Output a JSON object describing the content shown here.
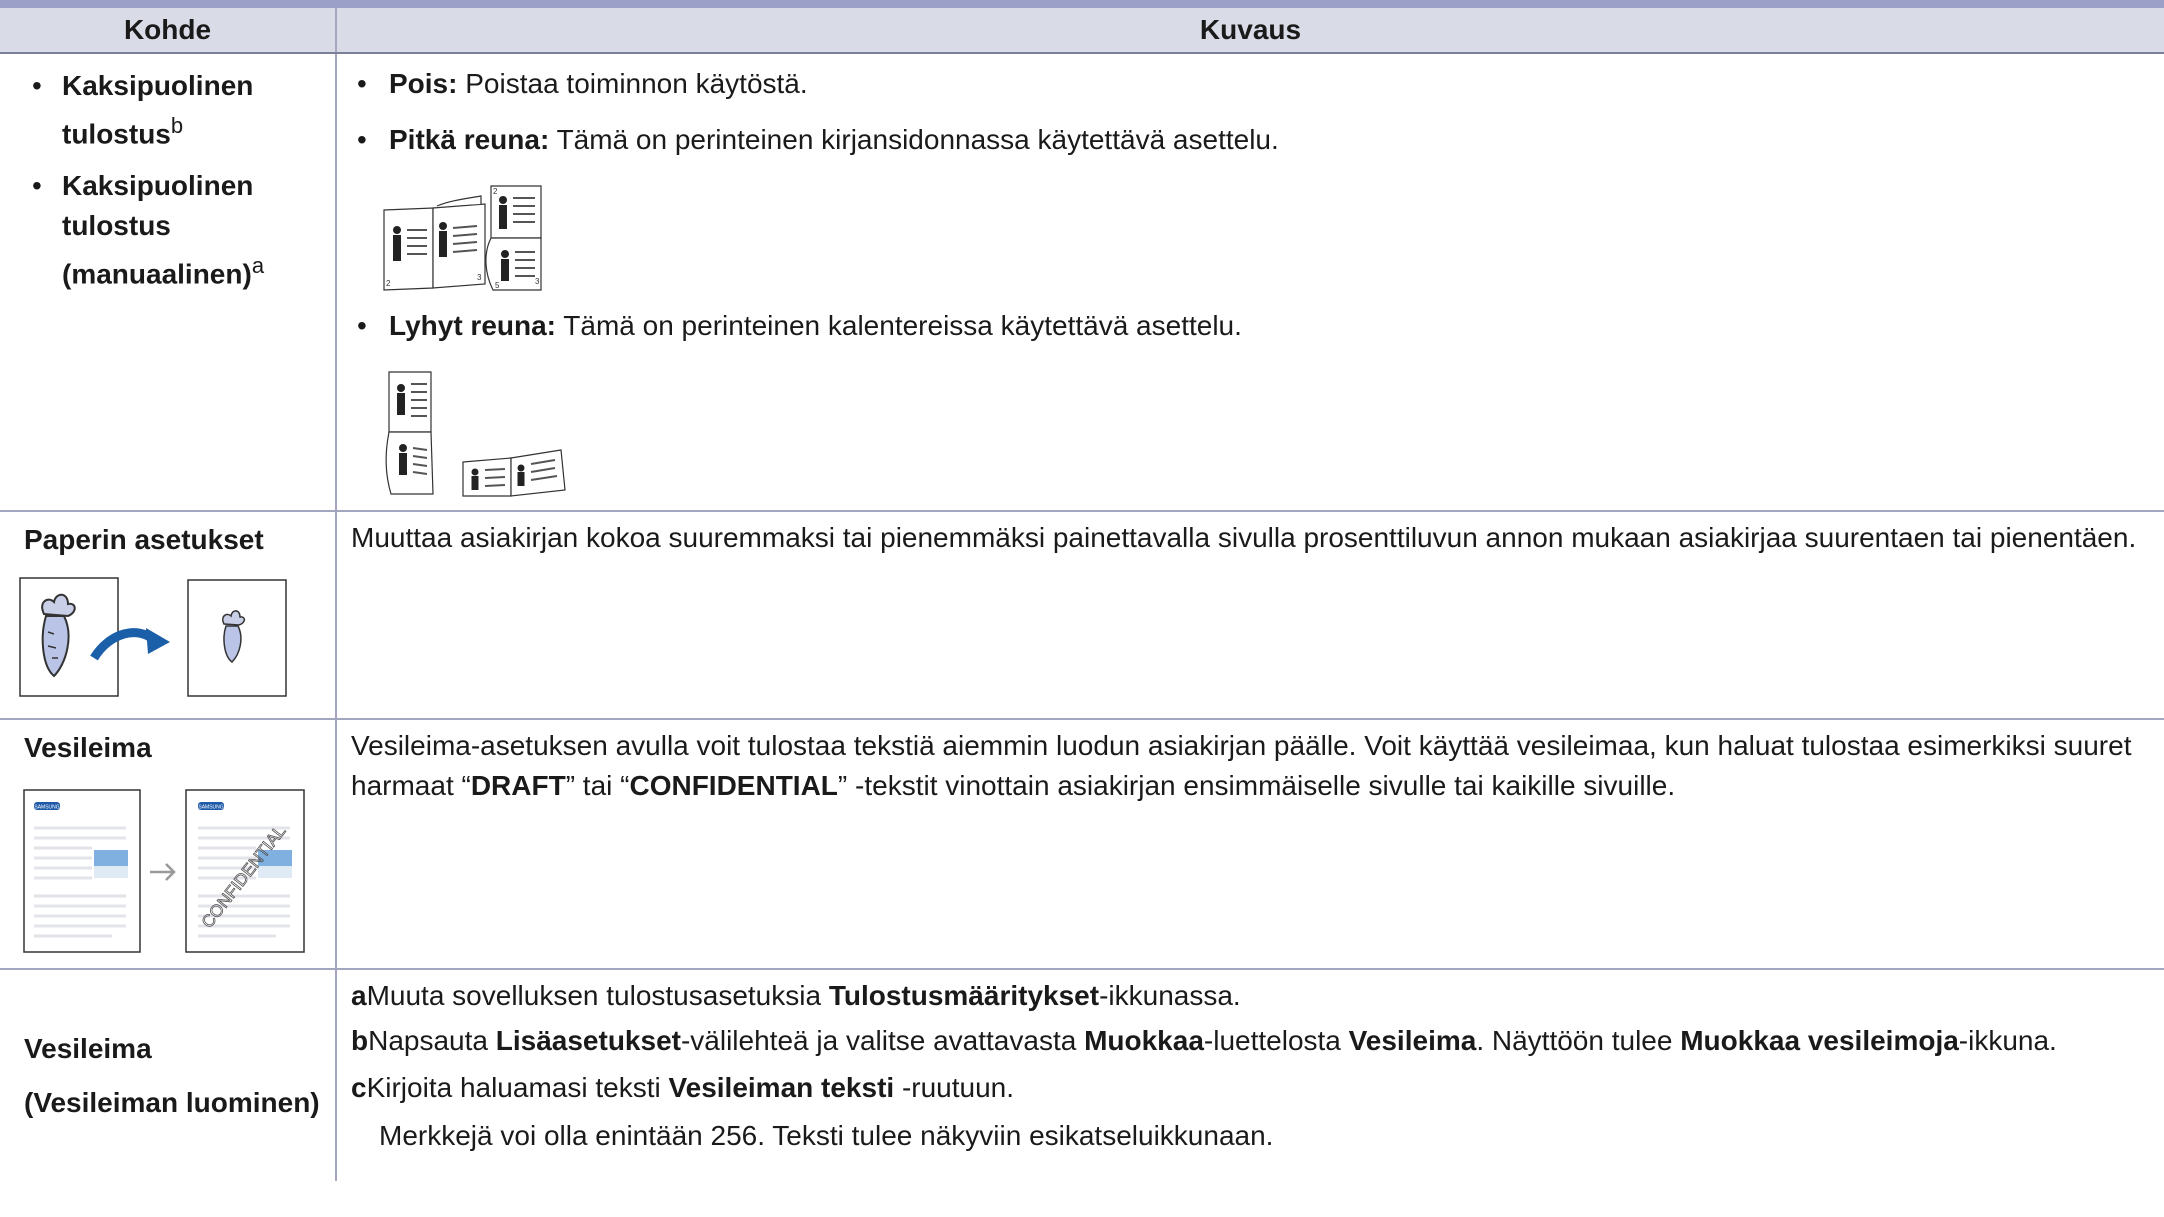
{
  "header": {
    "col1": "Kohde",
    "col2": "Kuvaus"
  },
  "rows": {
    "duplex": {
      "items": [
        {
          "bullet": "•",
          "label": "Kaksipuolinen tulostus",
          "sup": "b"
        },
        {
          "bullet": "•",
          "label": "Kaksipuolinen tulostus (manuaalinen)",
          "sup": "a"
        }
      ],
      "options": [
        {
          "bullet": "•",
          "term": "Pois:",
          "text": "Poistaa toiminnon käytöstä."
        },
        {
          "bullet": "•",
          "term": "Pitkä reuna:",
          "text": "Tämä on perinteinen kirjansidonnassa käytettävä asettelu."
        },
        {
          "bullet": "•",
          "term": "Lyhyt reuna:",
          "text": "Tämä on perinteinen kalentereissa käytettävä asettelu."
        }
      ],
      "page_numbers": [
        "2",
        "3",
        "2",
        "3",
        "5"
      ]
    },
    "paper": {
      "label": "Paperin asetukset",
      "description": "Muuttaa asiakirjan kokoa suuremmaksi tai pienemmäksi painettavalla sivulla prosenttiluvun annon mukaan asiakirjaa suurentaen tai pienentäen."
    },
    "watermark": {
      "label": "Vesileima",
      "desc_p1": "Vesileima-asetuksen avulla voit tulostaa tekstiä aiemmin luodun asiakirjan päälle. Voit käyttää vesileimaa, kun haluat tulostaa esimerkiksi suuret harmaat “",
      "desc_b1": "DRAFT",
      "desc_p2": "” tai “",
      "desc_b2": "CONFIDENTIAL",
      "desc_p3": "” -tekstit vinottain asiakirjan ensimmäiselle sivulle tai kaikille sivuille.",
      "stamp_text": "CONFIDENTIAL",
      "logo_text": "SAMSUNG"
    },
    "watermark_create": {
      "label1": "Vesileima",
      "label2": "(Vesileiman luominen)",
      "a_key": "a",
      "a_text1": "Muuta sovelluksen tulostusasetuksia ",
      "a_b": "Tulostusmääritykset",
      "a_text2": "-ikkunassa.",
      "b_key": "b",
      "b_text1": "Napsauta ",
      "b_b1": "Lisäasetukset",
      "b_text2": "-välilehteä ja valitse avattavasta ",
      "b_b2": "Muokkaa",
      "b_text3": "-luettelosta ",
      "b_b3": "Vesileima",
      "b_text4": ". Näyttöön tulee ",
      "b_b4": "Muokkaa vesileimoja",
      "b_text5": "-ikkuna.",
      "c_key": "c",
      "c_text1": "Kirjoita haluamasi teksti ",
      "c_b": "Vesileiman teksti",
      "c_text2": " -ruutuun.",
      "c_note": "Merkkejä voi olla enintään 256. Teksti tulee näkyviin esikatseluikkunaan."
    }
  },
  "colors": {
    "header_bg": "#d9dbe6",
    "top_rule": "#9aa0c8",
    "grid": "#a3a6bf",
    "arrow_blue": "#1b5fa8",
    "carrot_fill": "#b9c4e6"
  }
}
